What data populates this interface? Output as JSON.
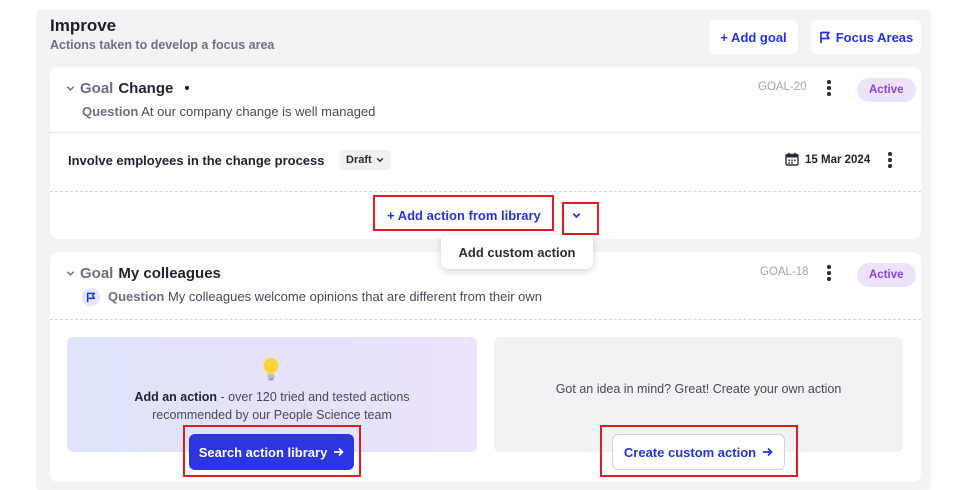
{
  "header": {
    "title": "Improve",
    "subtitle": "Actions taken to develop a focus area",
    "add_goal_label": "+ Add goal",
    "focus_areas_label": "Focus Areas"
  },
  "goals": [
    {
      "goal_word": "Goal",
      "name": "Change",
      "status_dot": "•",
      "question_label": "Question",
      "question_text": "At our company change is well managed",
      "goal_id": "GOAL-20",
      "status": "Active",
      "action": {
        "title": "Involve employees in the change process",
        "state": "Draft",
        "date": "15 Mar 2024"
      },
      "add_from_library_label": "+ Add action from library",
      "dropdown_item": "Add custom action"
    },
    {
      "goal_word": "Goal",
      "name": "My colleagues",
      "question_label": "Question",
      "question_text": "My colleagues welcome opinions that are different from their own",
      "goal_id": "GOAL-18",
      "status": "Active",
      "library_box": {
        "lead": "Add an action",
        "text_line1": " - over 120 tried and tested actions",
        "text_line2": "recommended by our People Science team",
        "button_label": "Search action library"
      },
      "custom_box": {
        "text": "Got an idea in mind? Great! Create your own action",
        "button_label": "Create custom action"
      }
    }
  ],
  "colors": {
    "accent": "#2433e0",
    "primary_button": "#2b36e0",
    "active_badge_bg": "#ece3fb",
    "active_badge_text": "#8b46d9",
    "highlight": "#e01b24"
  },
  "icons": {
    "flag": "flag-icon",
    "calendar": "calendar-icon",
    "bulb": "lightbulb-icon",
    "arrow": "arrow-right-icon",
    "chevron": "chevron-down-icon",
    "kebab": "kebab-menu-icon"
  }
}
